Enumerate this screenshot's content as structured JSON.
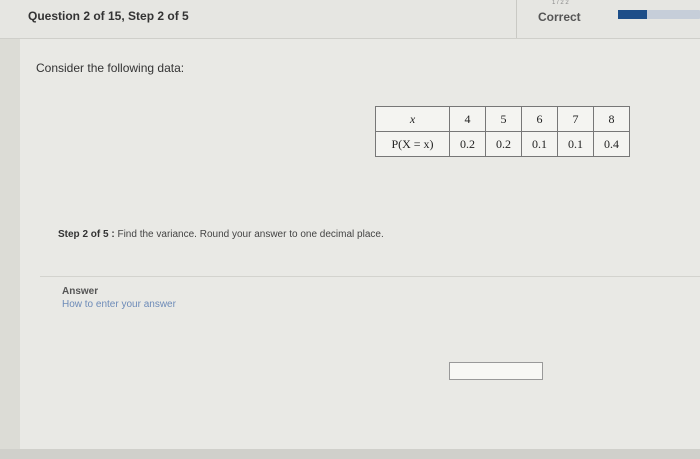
{
  "header": {
    "question_label": "Question 2 of 15, Step 2 of 5",
    "status_label": "Correct",
    "status_top": "1 / 2 2",
    "progress_fraction": 0.35
  },
  "main": {
    "prompt": "Consider the following data:",
    "table": {
      "row_headers": [
        "x",
        "P(X = x)"
      ],
      "x_values": [
        "4",
        "5",
        "6",
        "7",
        "8"
      ],
      "p_values": [
        "0.2",
        "0.2",
        "0.1",
        "0.1",
        "0.4"
      ]
    },
    "step": {
      "label": "Step 2 of 5 :",
      "instruction": "Find the variance. Round your answer to one decimal place."
    },
    "answer": {
      "label": "Answer",
      "help_link": "How to enter your answer",
      "value": ""
    }
  },
  "colors": {
    "progress_accent": "#1d4e89",
    "link": "#6d8bb8"
  }
}
